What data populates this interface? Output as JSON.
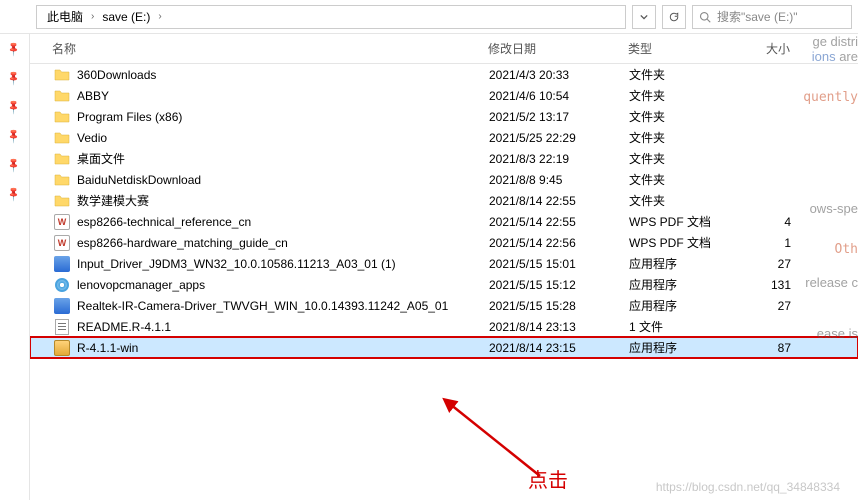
{
  "breadcrumb": {
    "root": "此电脑",
    "folder": "save (E:)"
  },
  "search": {
    "placeholder": "搜索\"save (E:)\""
  },
  "columns": {
    "name": "名称",
    "date": "修改日期",
    "type": "类型",
    "size": "大小"
  },
  "files": [
    {
      "name": "360Downloads",
      "date": "2021/4/3 20:33",
      "type": "文件夹",
      "size": "",
      "icon": "folder",
      "selected": false
    },
    {
      "name": "ABBY",
      "date": "2021/4/6 10:54",
      "type": "文件夹",
      "size": "",
      "icon": "folder",
      "selected": false
    },
    {
      "name": "Program Files (x86)",
      "date": "2021/5/2 13:17",
      "type": "文件夹",
      "size": "",
      "icon": "folder",
      "selected": false
    },
    {
      "name": "Vedio",
      "date": "2021/5/25 22:29",
      "type": "文件夹",
      "size": "",
      "icon": "folder",
      "selected": false
    },
    {
      "name": "桌面文件",
      "date": "2021/8/3 22:19",
      "type": "文件夹",
      "size": "",
      "icon": "folder",
      "selected": false
    },
    {
      "name": "BaiduNetdiskDownload",
      "date": "2021/8/8 9:45",
      "type": "文件夹",
      "size": "",
      "icon": "folder",
      "selected": false
    },
    {
      "name": "数学建模大赛",
      "date": "2021/8/14 22:55",
      "type": "文件夹",
      "size": "",
      "icon": "folder",
      "selected": false
    },
    {
      "name": "esp8266-technical_reference_cn",
      "date": "2021/5/14 22:55",
      "type": "WPS PDF 文档",
      "size": "4",
      "icon": "pdf",
      "selected": false
    },
    {
      "name": "esp8266-hardware_matching_guide_cn",
      "date": "2021/5/14 22:56",
      "type": "WPS PDF 文档",
      "size": "1",
      "icon": "pdf",
      "selected": false
    },
    {
      "name": "Input_Driver_J9DM3_WN32_10.0.10586.11213_A03_01 (1)",
      "date": "2021/5/15 15:01",
      "type": "应用程序",
      "size": "27",
      "icon": "exe",
      "selected": false
    },
    {
      "name": "lenovopcmanager_apps",
      "date": "2021/5/15 15:12",
      "type": "应用程序",
      "size": "131",
      "icon": "disc",
      "selected": false
    },
    {
      "name": "Realtek-IR-Camera-Driver_TWVGH_WIN_10.0.14393.11242_A05_01",
      "date": "2021/5/15 15:28",
      "type": "应用程序",
      "size": "27",
      "icon": "exe",
      "selected": false
    },
    {
      "name": "README.R-4.1.1",
      "date": "2021/8/14 23:13",
      "type": "1 文件",
      "size": "",
      "icon": "text",
      "selected": false
    },
    {
      "name": "R-4.1.1-win",
      "date": "2021/8/14 23:15",
      "type": "应用程序",
      "size": "87",
      "icon": "installer",
      "selected": true
    }
  ],
  "annotation": {
    "label": "点击"
  },
  "background_text": {
    "l1a": "ge distri",
    "l1b": "ions",
    "l1c": " are",
    "l2": "quently",
    "l3": "ows-spe",
    "l4": "Oth",
    "l5": "release c",
    "l6": "ease is"
  },
  "watermark": "https://blog.csdn.net/qq_34848334"
}
